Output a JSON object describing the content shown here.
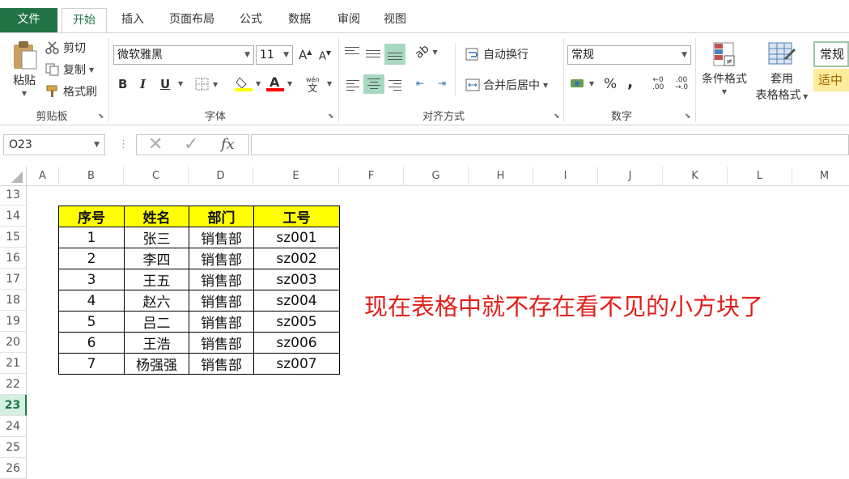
{
  "tabs": {
    "file": "文件",
    "home": "开始",
    "insert": "插入",
    "layout": "页面布局",
    "formulas": "公式",
    "data": "数据",
    "review": "审阅",
    "view": "视图"
  },
  "clipboard": {
    "paste": "粘贴",
    "cut": "剪切",
    "copy": "复制",
    "painter": "格式刷",
    "label": "剪贴板"
  },
  "font": {
    "name": "微软雅黑",
    "size": "11",
    "bold": "B",
    "italic": "I",
    "underline": "U",
    "label": "字体",
    "wen_top": "wén",
    "wen_char": "文",
    "font_color": "#ff0000",
    "fill_color": "#ffff00"
  },
  "alignment": {
    "wrap": "自动换行",
    "merge": "合并后居中",
    "label": "对齐方式"
  },
  "number": {
    "format": "常规",
    "percent": "%",
    "comma": ",",
    "label": "数字",
    "inc_decimal": ".00",
    "dec_decimal": ".0"
  },
  "styles": {
    "cond_format": "条件格式",
    "table_fmt_1": "套用",
    "table_fmt_2": "表格格式",
    "style_normal": "常规",
    "style_neutral": "适中"
  },
  "formula_bar": {
    "namebox": "O23",
    "fx": "fx",
    "value": ""
  },
  "columns": [
    "A",
    "B",
    "C",
    "D",
    "E",
    "F",
    "G",
    "H",
    "I",
    "J",
    "K",
    "L",
    "M"
  ],
  "rows": [
    "13",
    "14",
    "15",
    "16",
    "17",
    "18",
    "19",
    "20",
    "21",
    "22",
    "23",
    "24",
    "25",
    "26"
  ],
  "selected_row": "23",
  "table": {
    "headers": [
      "序号",
      "姓名",
      "部门",
      "工号"
    ],
    "rows": [
      [
        "1",
        "张三",
        "销售部",
        "sz001"
      ],
      [
        "2",
        "李四",
        "销售部",
        "sz002"
      ],
      [
        "3",
        "王五",
        "销售部",
        "sz003"
      ],
      [
        "4",
        "赵六",
        "销售部",
        "sz004"
      ],
      [
        "5",
        "吕二",
        "销售部",
        "sz005"
      ],
      [
        "6",
        "王浩",
        "销售部",
        "sz006"
      ],
      [
        "7",
        "杨强强",
        "销售部",
        "sz007"
      ]
    ]
  },
  "note": "现在表格中就不存在看不见的小方块了",
  "colors": {
    "excel_green": "#217346",
    "header_fill": "#ffff00",
    "note_red": "#e0201b"
  }
}
